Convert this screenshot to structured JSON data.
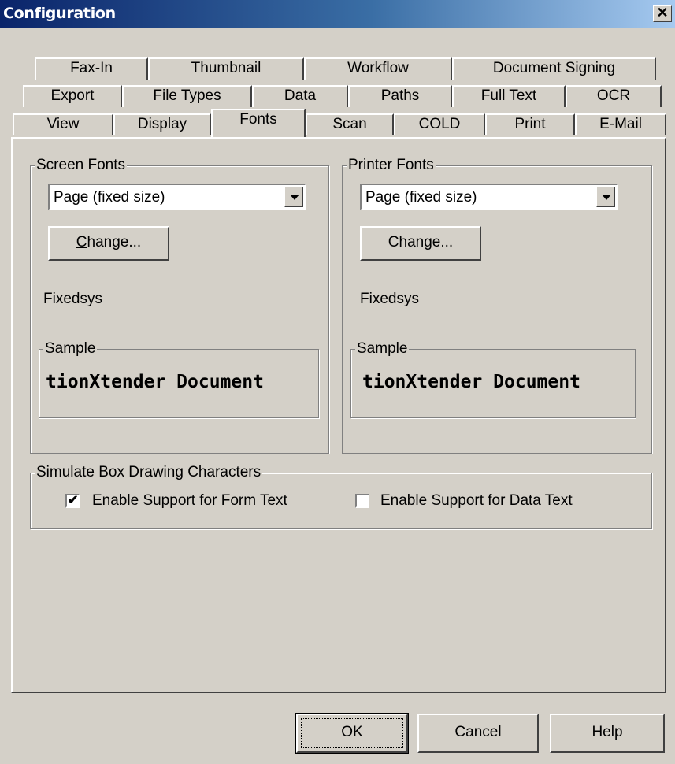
{
  "window": {
    "title": "Configuration",
    "close_glyph": "✕"
  },
  "tabs": {
    "row1": [
      "Fax-In",
      "Thumbnail",
      "Workflow",
      "Document Signing"
    ],
    "row2": [
      "Export",
      "File Types",
      "Data",
      "Paths",
      "Full Text",
      "OCR"
    ],
    "row3": [
      "View",
      "Display",
      "Fonts",
      "Scan",
      "COLD",
      "Print",
      "E-Mail"
    ],
    "active": "Fonts"
  },
  "screen_fonts": {
    "legend": "Screen Fonts",
    "selected": "Page (fixed size)",
    "change_prefix": "",
    "change_accel": "C",
    "change_rest": "hange...",
    "font_name": "Fixedsys",
    "sample_legend": "Sample",
    "sample_text": "tionXtender Document"
  },
  "printer_fonts": {
    "legend": "Printer Fonts",
    "selected": "Page (fixed size)",
    "change_label": "Change...",
    "font_name": "Fixedsys",
    "sample_legend": "Sample",
    "sample_text": "tionXtender Document"
  },
  "box_drawing": {
    "legend": "Simulate Box Drawing Characters",
    "form_text_label": "Enable Support for Form Text",
    "form_text_checked": true,
    "data_text_label": "Enable Support for Data Text",
    "data_text_checked": false,
    "check_glyph": "✔"
  },
  "buttons": {
    "ok": "OK",
    "cancel": "Cancel",
    "help": "Help"
  }
}
